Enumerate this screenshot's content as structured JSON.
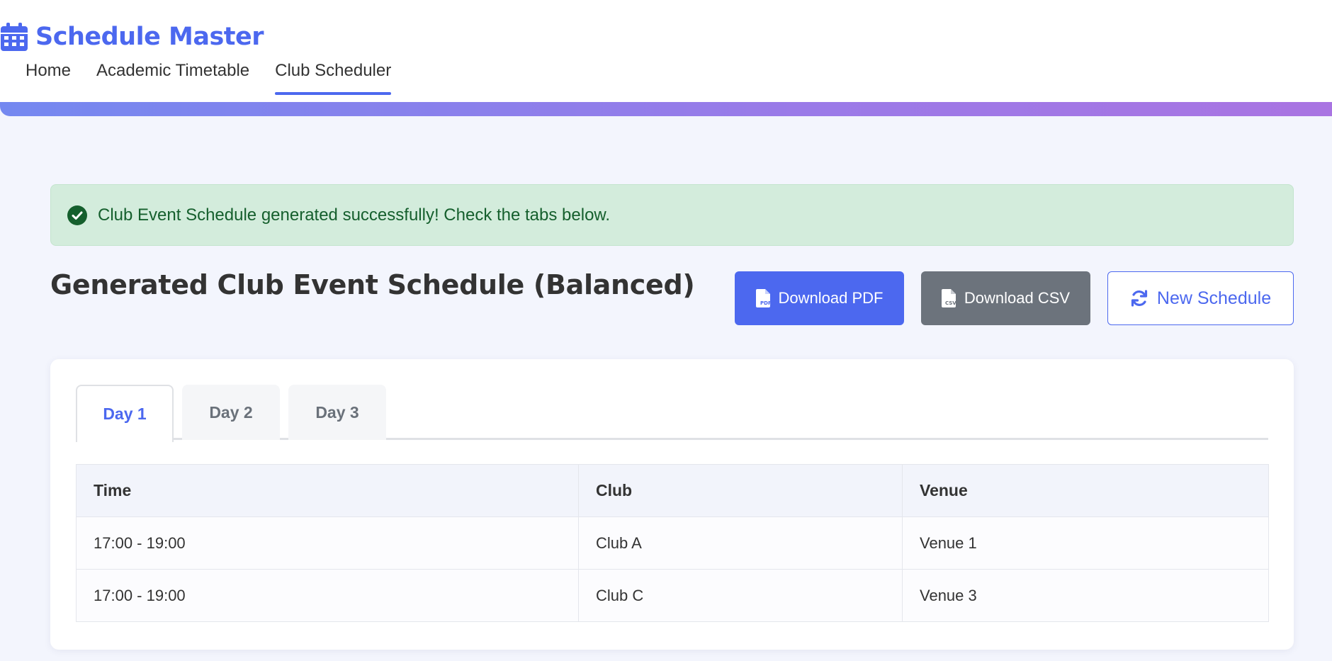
{
  "brand": {
    "title": "Schedule Master",
    "icon": "calendar-icon"
  },
  "nav": {
    "items": [
      {
        "label": "Home",
        "active": false
      },
      {
        "label": "Academic Timetable",
        "active": false
      },
      {
        "label": "Club Scheduler",
        "active": true
      }
    ]
  },
  "alert": {
    "icon": "check-circle-icon",
    "message": "Club Event Schedule generated successfully! Check the tabs below."
  },
  "page": {
    "title": "Generated Club Event Schedule (Balanced)"
  },
  "actions": {
    "download_pdf": "Download PDF",
    "download_csv": "Download CSV",
    "new_schedule": "New Schedule"
  },
  "tabs": [
    {
      "label": "Day 1",
      "active": true
    },
    {
      "label": "Day 2",
      "active": false
    },
    {
      "label": "Day 3",
      "active": false
    }
  ],
  "table": {
    "headers": [
      "Time",
      "Club",
      "Venue"
    ],
    "rows": [
      [
        "17:00 - 19:00",
        "Club A",
        "Venue 1"
      ],
      [
        "17:00 - 19:00",
        "Club C",
        "Venue 3"
      ]
    ]
  },
  "colors": {
    "accent": "#4c68ef",
    "secondary": "#6c737c",
    "success_bg": "#d3ecdc",
    "success_text": "#155f2d"
  }
}
